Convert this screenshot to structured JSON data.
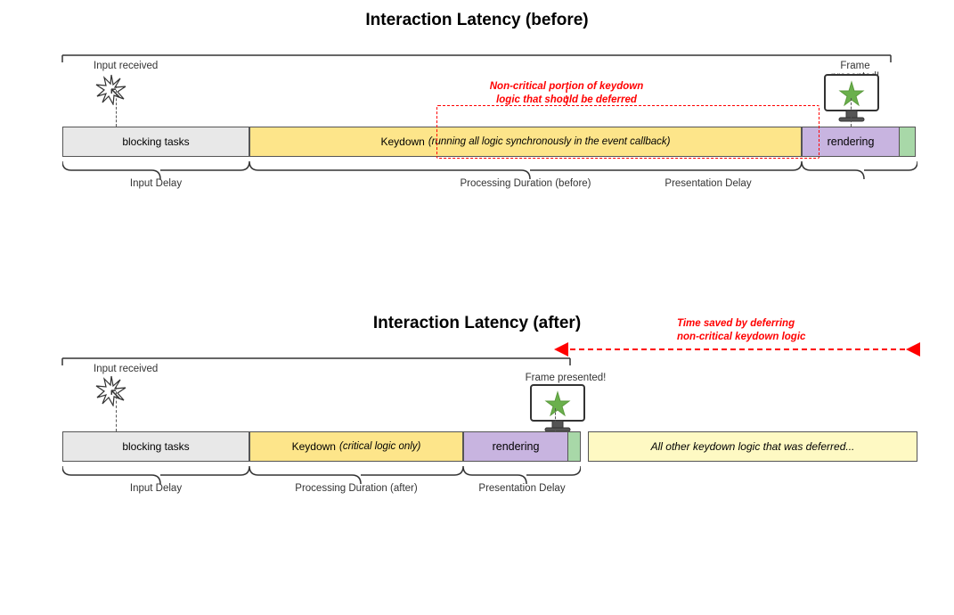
{
  "top": {
    "title": "Interaction Latency (before)",
    "input_received": "Input received",
    "frame_presented": "Frame presented!",
    "bars": {
      "blocking": "blocking tasks",
      "keydown": "Keydown",
      "keydown_italic": "(running all logic synchronously in the event callback)",
      "rendering": "rendering"
    },
    "labels": {
      "input_delay": "Input Delay",
      "processing_duration": "Processing Duration (before)",
      "presentation_delay": "Presentation Delay"
    },
    "annotation": {
      "line1": "Non-critical portion of keydown",
      "line2": "logic that should be deferred"
    }
  },
  "bottom": {
    "title": "Interaction Latency (after)",
    "input_received": "Input received",
    "frame_presented": "Frame presented!",
    "bars": {
      "blocking": "blocking tasks",
      "keydown": "Keydown",
      "keydown_italic": "(critical logic only)",
      "rendering": "rendering",
      "deferred": "All other keydown logic that was deferred..."
    },
    "labels": {
      "input_delay": "Input Delay",
      "processing_duration": "Processing Duration (after)",
      "presentation_delay": "Presentation Delay"
    },
    "annotation": {
      "line1": "Time saved by deferring",
      "line2": "non-critical keydown logic"
    }
  }
}
